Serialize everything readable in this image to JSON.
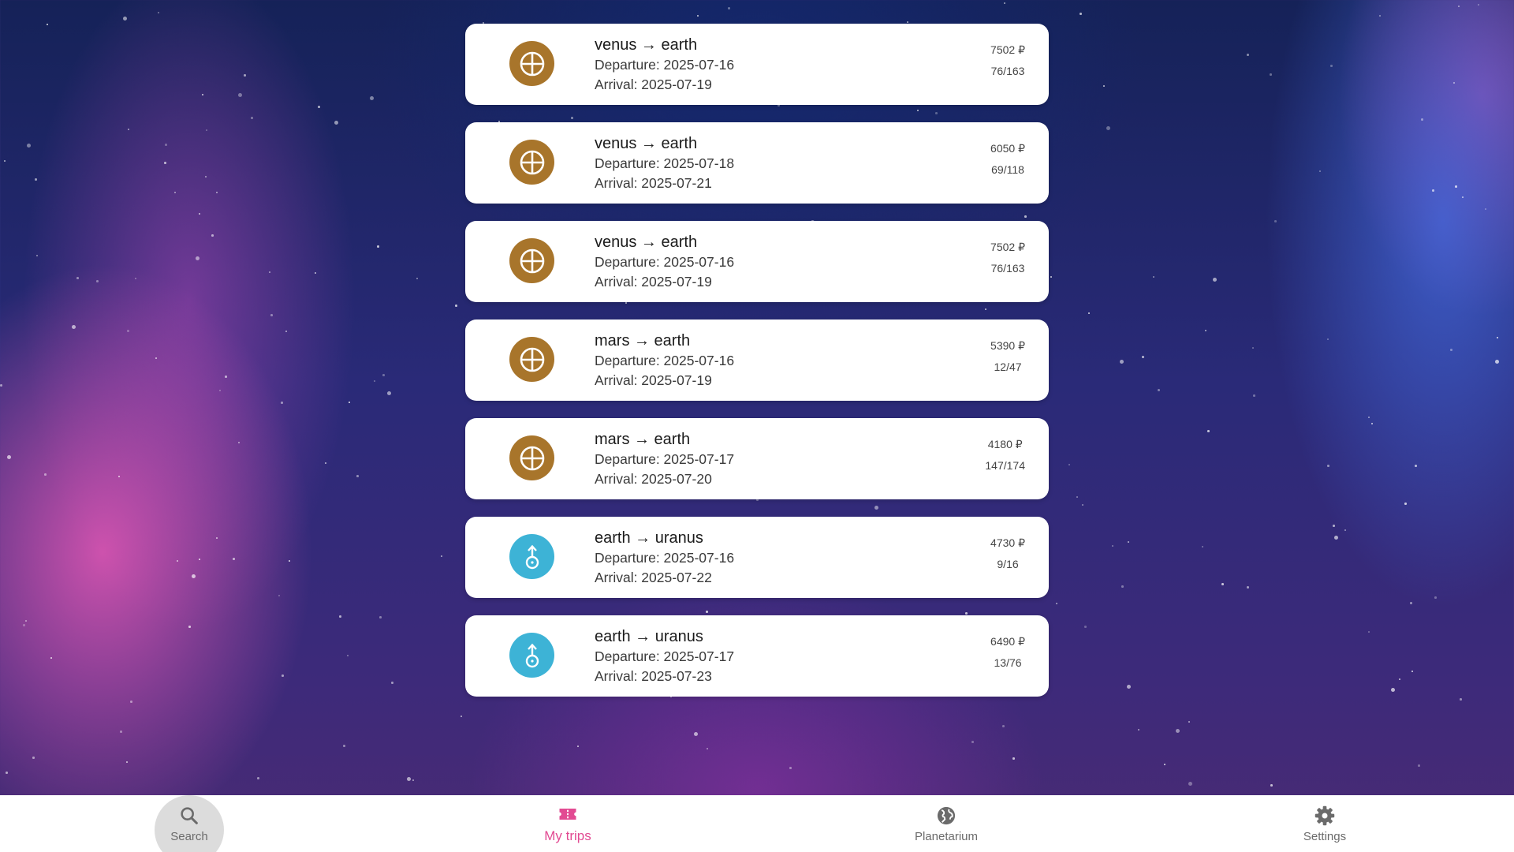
{
  "colors": {
    "venus_icon": "#a8752b",
    "uranus_icon": "#3db3d6",
    "active_tab": "#e24a92",
    "inactive_tab": "#6b6b6b"
  },
  "trips": [
    {
      "route": "venus → earth",
      "departure": "Departure: 2025-07-16",
      "arrival": "Arrival: 2025-07-19",
      "price": "7502 ₽",
      "seats": "76/163",
      "icon": "earth-cross-symbol-icon"
    },
    {
      "route": "venus → earth",
      "departure": "Departure: 2025-07-18",
      "arrival": "Arrival: 2025-07-21",
      "price": "6050 ₽",
      "seats": "69/118",
      "icon": "earth-cross-symbol-icon"
    },
    {
      "route": "venus → earth",
      "departure": "Departure: 2025-07-16",
      "arrival": "Arrival: 2025-07-19",
      "price": "7502 ₽",
      "seats": "76/163",
      "icon": "earth-cross-symbol-icon"
    },
    {
      "route": "mars → earth",
      "departure": "Departure: 2025-07-16",
      "arrival": "Arrival: 2025-07-19",
      "price": "5390 ₽",
      "seats": "12/47",
      "icon": "earth-cross-symbol-icon"
    },
    {
      "route": "mars → earth",
      "departure": "Departure: 2025-07-17",
      "arrival": "Arrival: 2025-07-20",
      "price": "4180 ₽",
      "seats": "147/174",
      "icon": "earth-cross-symbol-icon"
    },
    {
      "route": "earth → uranus",
      "departure": "Departure: 2025-07-16",
      "arrival": "Arrival: 2025-07-22",
      "price": "4730 ₽",
      "seats": "9/16",
      "icon": "uranus-symbol-icon"
    },
    {
      "route": "earth → uranus",
      "departure": "Departure: 2025-07-17",
      "arrival": "Arrival: 2025-07-23",
      "price": "6490 ₽",
      "seats": "13/76",
      "icon": "uranus-symbol-icon"
    }
  ],
  "nav": {
    "search": {
      "label": "Search",
      "icon": "search-icon"
    },
    "my_trips": {
      "label": "My trips",
      "icon": "ticket-icon",
      "active": true
    },
    "planetarium": {
      "label": "Planetarium",
      "icon": "globe-icon"
    },
    "settings": {
      "label": "Settings",
      "icon": "gear-icon"
    }
  }
}
